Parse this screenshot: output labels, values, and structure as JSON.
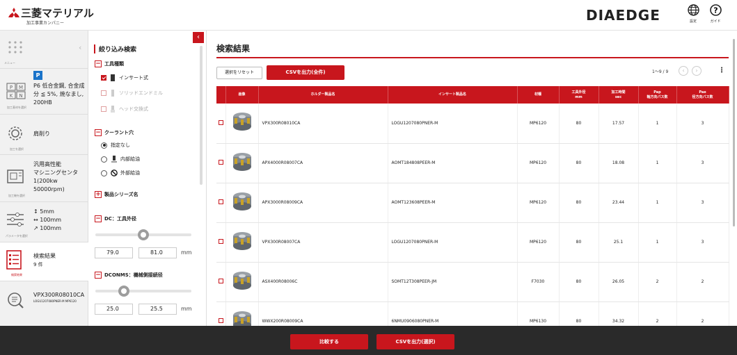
{
  "header": {
    "brand_name": "三菱マテリアル",
    "brand_sub": "加工事業カンパニー",
    "product_logo": "DIAEDGE",
    "settings_label": "設定",
    "guide_label": "ガイド"
  },
  "nav": {
    "menu_label": "メニュー",
    "items": [
      {
        "icon": "material-icon",
        "caption": "加工基材を選択",
        "badge": "P",
        "text": [
          "P6 低合金鋼, 合金成",
          "分 ≦ 5%, 焼なまし,",
          "200HB"
        ]
      },
      {
        "icon": "process-icon",
        "caption": "加工を選択",
        "text": [
          "肩削り"
        ]
      },
      {
        "icon": "machine-icon",
        "caption": "加工機を選択",
        "text": [
          "汎用高性能",
          "マシニングセンタ",
          "1(200kw",
          "50000rpm)"
        ]
      },
      {
        "icon": "parameter-icon",
        "caption": "パラメータを選択",
        "text": [
          "↕ 5mm",
          "↔ 100mm",
          "↗ 100mm"
        ]
      },
      {
        "icon": "result-icon",
        "caption": "検索結果",
        "text": [
          "検索結果",
          "9 件"
        ]
      },
      {
        "icon": "detail-icon",
        "caption": "",
        "text": [
          "VPX300R08010CA",
          "LOGU1207080PNER-M MP6120"
        ]
      }
    ]
  },
  "filter": {
    "title": "絞り込み検索",
    "tool_type": {
      "label": "工具種類",
      "options": [
        {
          "label": "インサート式",
          "checked": true,
          "disabled": false
        },
        {
          "label": "ソリッドエンドミル",
          "checked": false,
          "disabled": true
        },
        {
          "label": "ヘッド交換式",
          "checked": false,
          "disabled": true
        }
      ]
    },
    "coolant": {
      "label": "クーラント穴",
      "options": [
        {
          "label": "指定なし",
          "selected": true
        },
        {
          "label": "内部給油",
          "selected": false
        },
        {
          "label": "外部給油",
          "selected": false
        }
      ]
    },
    "series": {
      "label": "製品シリーズ名"
    },
    "dc": {
      "label": "DC：工具外径",
      "min": "79.0",
      "max": "81.0",
      "unit": "mm",
      "knob_pos": 0.5
    },
    "dconms": {
      "label": "DCONMS：機械側接続径",
      "min": "25.0",
      "max": "25.5",
      "unit": "mm",
      "knob_pos": 0.27
    }
  },
  "main": {
    "title": "検索結果",
    "reset_label": "選択をリセット",
    "csv_all_label": "CSVを出力(全件)",
    "pager": "1～9 / 9",
    "columns": [
      "画像",
      "ホルダー製品名",
      "インサート製品名",
      "材種",
      "工具外径\nmm",
      "加工時間\nsec",
      "Pap\n軸方向パス数",
      "Pae\n径方向パス数"
    ],
    "rows": [
      {
        "holder": "VPX300R08010CA",
        "insert": "LOGU1207080PNER-M",
        "grade": "MP6120",
        "dia": "80",
        "time": "17.57",
        "pap": "1",
        "pae": "3"
      },
      {
        "holder": "APX4000R08007CA",
        "insert": "AOMT184808PEER-M",
        "grade": "MP6120",
        "dia": "80",
        "time": "18.08",
        "pap": "1",
        "pae": "3"
      },
      {
        "holder": "APX3000R08009CA",
        "insert": "AOMT123608PEER-M",
        "grade": "MP6120",
        "dia": "80",
        "time": "23.44",
        "pap": "1",
        "pae": "3"
      },
      {
        "holder": "VPX300R08007CA",
        "insert": "LOGU1207080PNER-M",
        "grade": "MP6120",
        "dia": "80",
        "time": "25.1",
        "pap": "1",
        "pae": "3"
      },
      {
        "holder": "ASX400R08006C",
        "insert": "SOMT12T308PEER-JM",
        "grade": "F7030",
        "dia": "80",
        "time": "26.05",
        "pap": "2",
        "pae": "2"
      },
      {
        "holder": "WWX200R08009CA",
        "insert": "6NMU0906080PNER-M",
        "grade": "MP6130",
        "dia": "80",
        "time": "34.32",
        "pap": "2",
        "pae": "2"
      }
    ]
  },
  "footer": {
    "compare_label": "比較する",
    "csv_selected_label": "CSVを出力(選択)"
  },
  "colors": {
    "accent": "#c8161d",
    "footer_bg": "#2a2a2a"
  }
}
